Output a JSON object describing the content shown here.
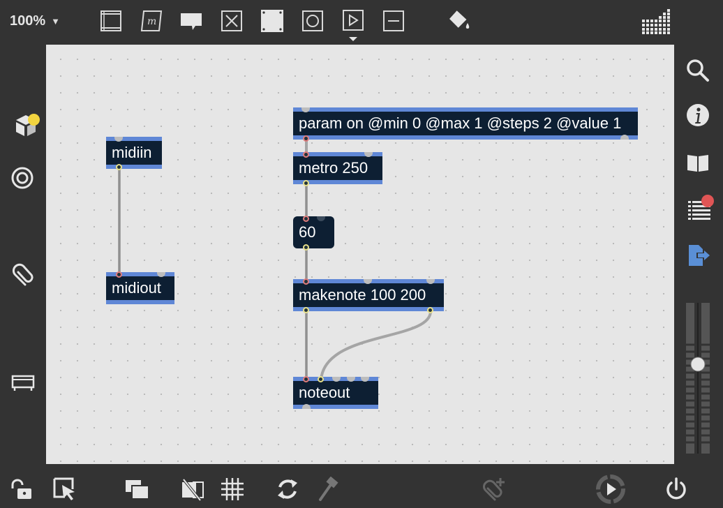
{
  "toolbar": {
    "zoom": "100%",
    "zoom_arrow": "▼"
  },
  "colors": {
    "chrome": "#333333",
    "canvas": "#e6e6e6",
    "object_fill": "#0d1f33",
    "object_border": "#5f87d6",
    "cord": "#a5a5a5",
    "badge_yellow": "#f2d43f",
    "badge_red": "#e05555",
    "accent_blue": "#5a8fd6"
  },
  "patch": {
    "objects": {
      "param": "param on @min 0 @max 1 @steps 2 @value 1",
      "metro": "metro 250",
      "number": "60",
      "makenote": "makenote 100 200",
      "noteout": "noteout",
      "midiin": "midiin",
      "midiout": "midiout"
    }
  },
  "icons": {
    "top": [
      "presentation-icon",
      "comment-icon",
      "message-icon",
      "toggle-icon",
      "bang-area-icon",
      "button-icon",
      "playbar-icon",
      "slider-icon",
      "paint-bucket-icon",
      "keyboard-grid-icon"
    ],
    "left": [
      "package-icon",
      "target-icon",
      "paperclip-icon",
      "device-view-icon"
    ],
    "right": [
      "search-icon",
      "info-icon",
      "reference-icon",
      "console-icon",
      "export-icon"
    ],
    "bottom": [
      "lock-icon",
      "edit-select-icon",
      "layers-icon",
      "hide-icon",
      "grid-icon",
      "refresh-icon",
      "hammer-icon",
      "add-attachment-icon",
      "play-icon",
      "power-icon"
    ]
  }
}
